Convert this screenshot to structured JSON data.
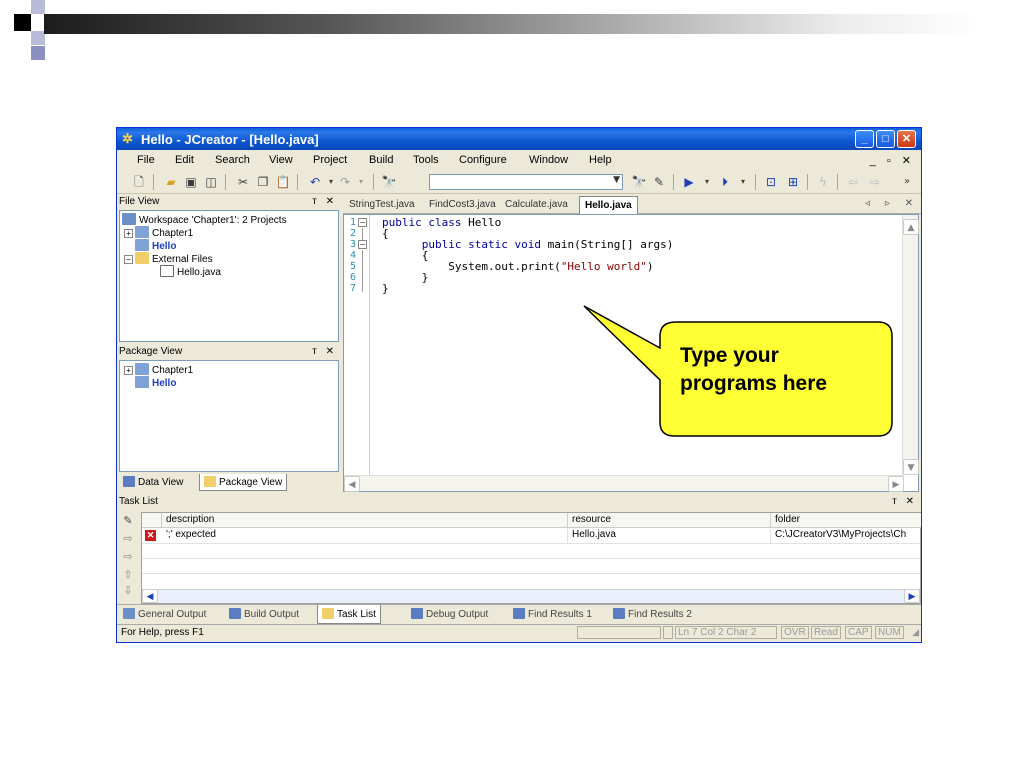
{
  "window": {
    "title": "Hello - JCreator - [Hello.java]",
    "min_label": "_",
    "max_label": "□",
    "close_label": "✕"
  },
  "menu": [
    "File",
    "Edit",
    "Search",
    "View",
    "Project",
    "Build",
    "Tools",
    "Configure",
    "Window",
    "Help"
  ],
  "file_view": {
    "header": "File View",
    "items": [
      {
        "label": "Workspace 'Chapter1': 2 Projects",
        "bold": false
      },
      {
        "label": "Chapter1",
        "bold": false
      },
      {
        "label": "Hello",
        "bold": true
      },
      {
        "label": "External Files",
        "bold": false
      },
      {
        "label": "Hello.java",
        "bold": false
      }
    ]
  },
  "package_view": {
    "header": "Package View",
    "items": [
      {
        "label": "Chapter1",
        "bold": false
      },
      {
        "label": "Hello",
        "bold": true
      }
    ]
  },
  "left_tabs": [
    "Data View",
    "Package View"
  ],
  "editor": {
    "tabs": [
      "StringTest.java",
      "FindCost3.java",
      "Calculate.java",
      "Hello.java"
    ],
    "active_tab": "Hello.java",
    "line_numbers": [
      "1",
      "2",
      "3",
      "4",
      "5",
      "6",
      "7"
    ],
    "lines": [
      {
        "kw": "public class ",
        "text": "Hello"
      },
      {
        "kw": "",
        "text": "{"
      },
      {
        "kw": "      public static void ",
        "text": "main(String[] args)"
      },
      {
        "kw": "",
        "text": "      {"
      },
      {
        "kw": "",
        "text": "          System.out.print(",
        "str": "\"Hello world\"",
        "tail": ")"
      },
      {
        "kw": "",
        "text": "      }"
      },
      {
        "kw": "",
        "text": "}"
      }
    ]
  },
  "callout": {
    "line1": "Type your",
    "line2": "programs here",
    "fill": "#ffff33",
    "stroke": "#000000"
  },
  "task_list": {
    "header": "Task List",
    "columns": [
      "description",
      "resource",
      "folder"
    ],
    "rows": [
      {
        "description": "';' expected",
        "resource": "Hello.java",
        "folder": "C:\\JCreatorV3\\MyProjects\\Ch"
      }
    ]
  },
  "output_tabs": [
    "General Output",
    "Build Output",
    "Task List",
    "Debug Output",
    "Find Results 1",
    "Find Results 2"
  ],
  "active_output_tab": "Task List",
  "status": {
    "help": "For Help, press F1",
    "position": "Ln 7  Col 2  Char 2",
    "flags": [
      "OVR",
      "Read",
      "CAP",
      "NUM"
    ]
  },
  "colors": {
    "title_blue": "#0a5fd8",
    "chrome": "#ece9d8",
    "project_blue": "#1d3fbc",
    "keyword": "#00009e"
  }
}
